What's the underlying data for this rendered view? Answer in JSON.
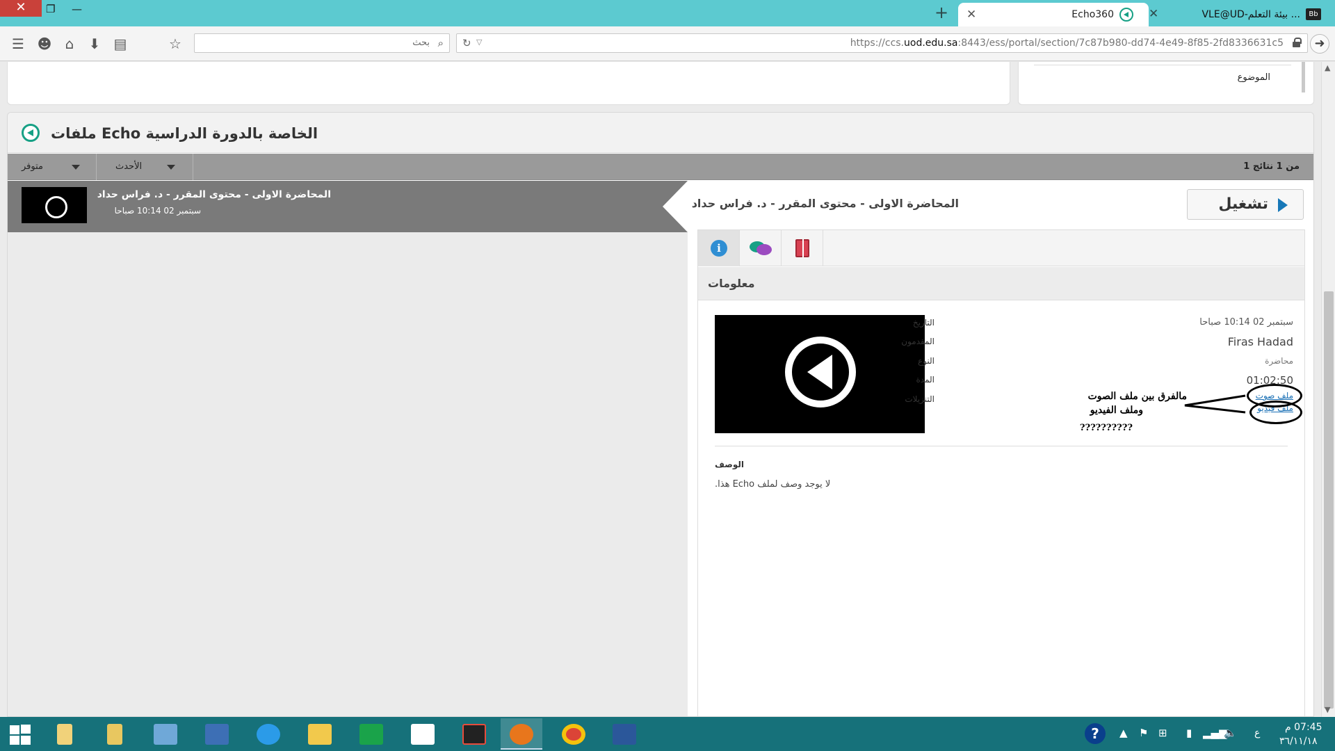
{
  "browser": {
    "tabs": [
      {
        "title": "Echo360",
        "active": true
      },
      {
        "title": "VLE@UD-بيئة التعلم ...",
        "active": false,
        "icon_text": "Bb"
      }
    ],
    "search_placeholder": "بحث",
    "url_prefix": "https://ccs.",
    "url_domain": "uod.edu.sa",
    "url_suffix": ":8443/ess/portal/section/7c87b980-dd74-4e49-8f85-2fd8336631c5"
  },
  "top_panel": {
    "topic_label": "الموضوع"
  },
  "echo_panel": {
    "title": "الخاصة بالدورة الدراسية Echo ملفات",
    "filters": {
      "available": "متوفر",
      "newest": "الأحدث"
    },
    "results_count": "من 1 نتائج 1",
    "list_item": {
      "title": "المحاضرة الاولى - محتوى المقرر - د. فراس حداد",
      "date": "سبتمبر 02 10:14 صباحا"
    },
    "detail": {
      "title": "المحاضرة الاولى - محتوى المقرر - د. فراس حداد",
      "play_label": "تشغيل",
      "info_heading": "معلومات",
      "labels": {
        "date": "التاريخ",
        "presenter": "المقدمون",
        "type": "النوع",
        "duration": "المدة",
        "downloads": "التنزيلات"
      },
      "values": {
        "date": "سبتمبر 02 10:14 صباحا",
        "presenter": "Firas Hadad",
        "type": "محاضرة",
        "duration": "01:02:50"
      },
      "downloads": {
        "audio": "ملف صوت",
        "video": "ملف فيديو"
      },
      "annotation": {
        "line1": "مالفرق بين ملف الصوت",
        "line2": "وملف الفيديو",
        "qmarks": "??????????"
      },
      "description_label": "الوصف",
      "description_text": "لا يوجد وصف لملف Echo هذا."
    }
  },
  "taskbar": {
    "lang": "ع",
    "time": "07:45 م",
    "date": "٣٦/١١/١٨"
  }
}
